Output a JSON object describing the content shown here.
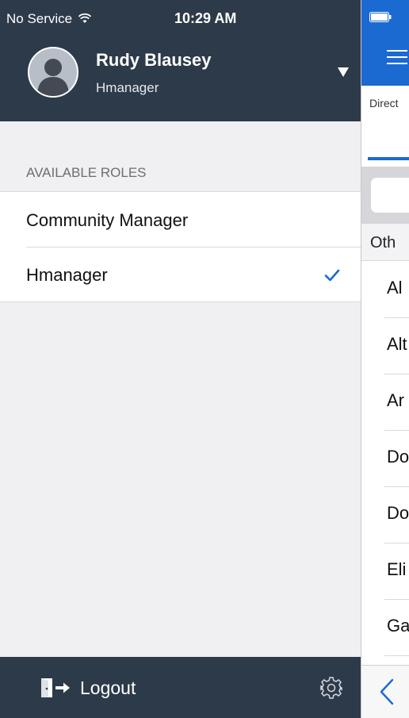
{
  "status_bar": {
    "carrier": "No Service",
    "time": "10:29 AM"
  },
  "user": {
    "name": "Rudy Blausey",
    "role": "Hmanager"
  },
  "roles": {
    "section_title": "AVAILABLE ROLES",
    "items": [
      {
        "label": "Community Manager",
        "selected": false
      },
      {
        "label": "Hmanager",
        "selected": true
      }
    ]
  },
  "footer": {
    "logout_label": "Logout"
  },
  "background_screen": {
    "tab_label": "Direct",
    "section_label": "Oth",
    "rows": [
      "Al",
      "Alt",
      "Ar",
      "Do",
      "Do",
      "Eli",
      "Ga"
    ]
  },
  "colors": {
    "header_bg": "#2d3a4a",
    "accent": "#1a6ad2",
    "check": "#1a6ad2"
  }
}
